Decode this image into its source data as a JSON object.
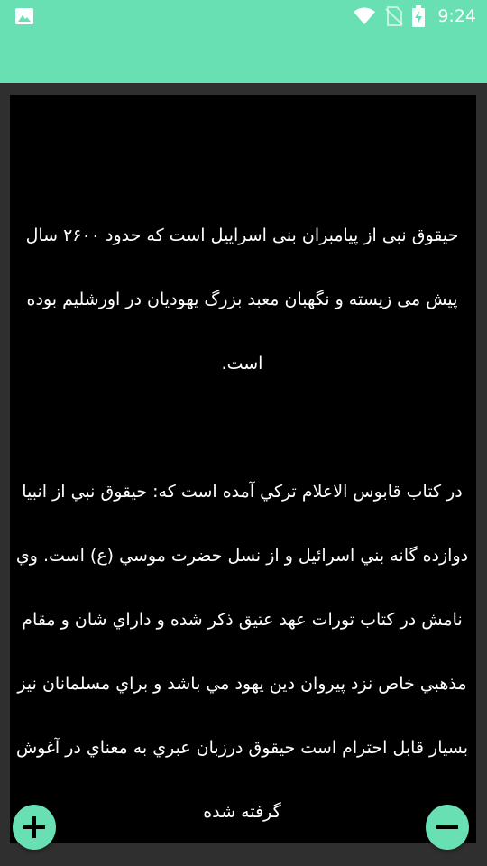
{
  "status_bar": {
    "time": "9:24",
    "icons": [
      "image-icon",
      "wifi-icon",
      "no-sim-icon",
      "battery-charging-icon"
    ]
  },
  "colors": {
    "accent": "#69dfb4",
    "content_background": "#000000",
    "text": "#ffffff",
    "frame": "#2f2f2f"
  },
  "content": {
    "paragraph1": "حیقوق نبی از پیامبران بنی اسراییل است که حدود ۲۶۰۰ سال پیش می زیسته و نگهبان معبد بزرگ یهودیان در اورشلیم بوده است.",
    "paragraph2": "در كتاب قابوس الاعلام تركي آمده است كه: حيقوق نبي از انبيا دوازده گانه بني اسرائيل و از نسل حضرت موسي (ع) است. وي نامش در كتاب تورات عهد عتيق ذكر شده و داراي شان و مقام مذهبي خاص نزد پيروان دين يهود مي باشد و براي مسلمانان نيز بسيار قابل احترام است حيقوق درزبان عبري به معناي در آغوش گرفته شده"
  },
  "fab": {
    "add_icon": "plus-icon",
    "remove_icon": "minus-icon"
  }
}
